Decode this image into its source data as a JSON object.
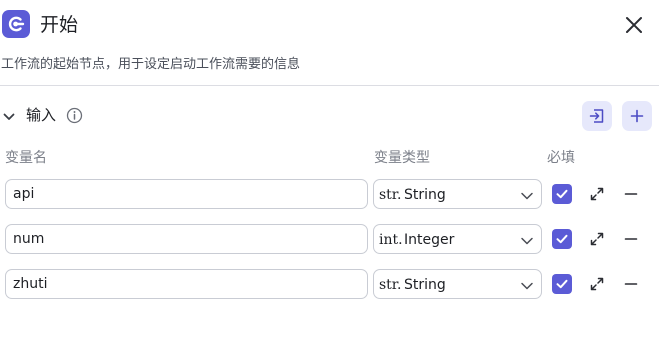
{
  "header": {
    "title": "开始",
    "description": "工作流的起始节点，用于设定启动工作流需要的信息"
  },
  "section": {
    "title": "输入"
  },
  "columns": {
    "name": "变量名",
    "type": "变量类型",
    "required": "必填"
  },
  "rows": [
    {
      "name": "api",
      "type_prefix": "str.",
      "type_label": "String",
      "required": true
    },
    {
      "name": "num",
      "type_prefix": "int.",
      "type_label": "Integer",
      "required": true
    },
    {
      "name": "zhuti",
      "type_prefix": "str.",
      "type_label": "String",
      "required": true
    }
  ],
  "colors": {
    "accent": "#5b5bd6",
    "accent_soft": "#e6e8fb",
    "border": "#c9ccd4",
    "muted_text": "#7c808a"
  },
  "icons": [
    "start-node-icon",
    "close-icon",
    "chevron-down-icon",
    "info-icon",
    "import-icon",
    "plus-icon",
    "check-icon",
    "expand-icon",
    "minus-icon"
  ]
}
